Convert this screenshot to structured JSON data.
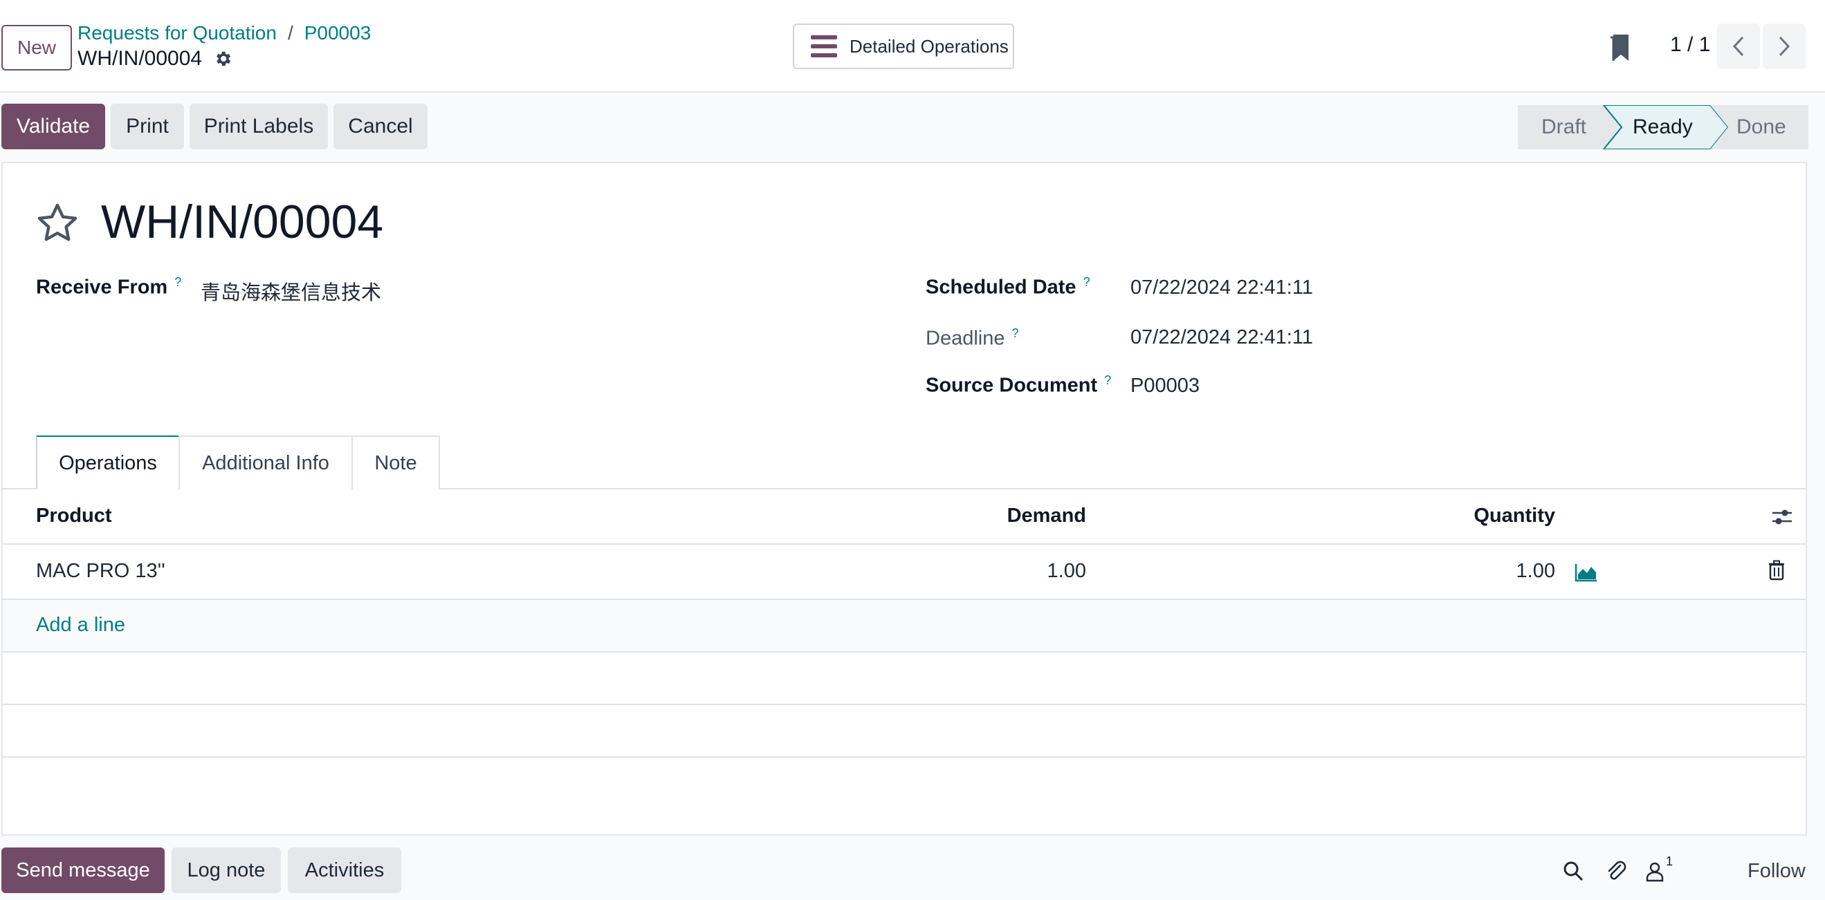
{
  "control": {
    "new_label": "New",
    "breadcrumb": [
      "Requests for Quotation",
      "P00003"
    ],
    "breadcrumb_sep": "/",
    "record_name": "WH/IN/00004",
    "detailed_operations_label": "Detailed Operations",
    "pager": "1 / 1"
  },
  "actions": {
    "validate": "Validate",
    "print": "Print",
    "print_labels": "Print Labels",
    "cancel": "Cancel"
  },
  "status": {
    "stages": [
      "Draft",
      "Ready",
      "Done"
    ],
    "current": "Ready"
  },
  "form": {
    "title": "WH/IN/00004",
    "receive_from_label": "Receive From",
    "receive_from": "青岛海森堡信息技术",
    "scheduled_date_label": "Scheduled Date",
    "scheduled_date": "07/22/2024 22:41:11",
    "deadline_label": "Deadline",
    "deadline": "07/22/2024 22:41:11",
    "source_document_label": "Source Document",
    "source_document": "P00003",
    "help_marker": "?"
  },
  "tabs": [
    "Operations",
    "Additional Info",
    "Note"
  ],
  "table": {
    "headers": [
      "Product",
      "Demand",
      "Quantity"
    ],
    "rows": [
      {
        "product": "MAC PRO 13''",
        "demand": "1.00",
        "quantity": "1.00"
      }
    ],
    "add_line": "Add a line"
  },
  "chatter": {
    "send_message": "Send message",
    "log_note": "Log note",
    "activities": "Activities",
    "followers_count": "1",
    "follow": "Follow"
  },
  "colors": {
    "primary": "#714b67",
    "link": "#017e84"
  }
}
